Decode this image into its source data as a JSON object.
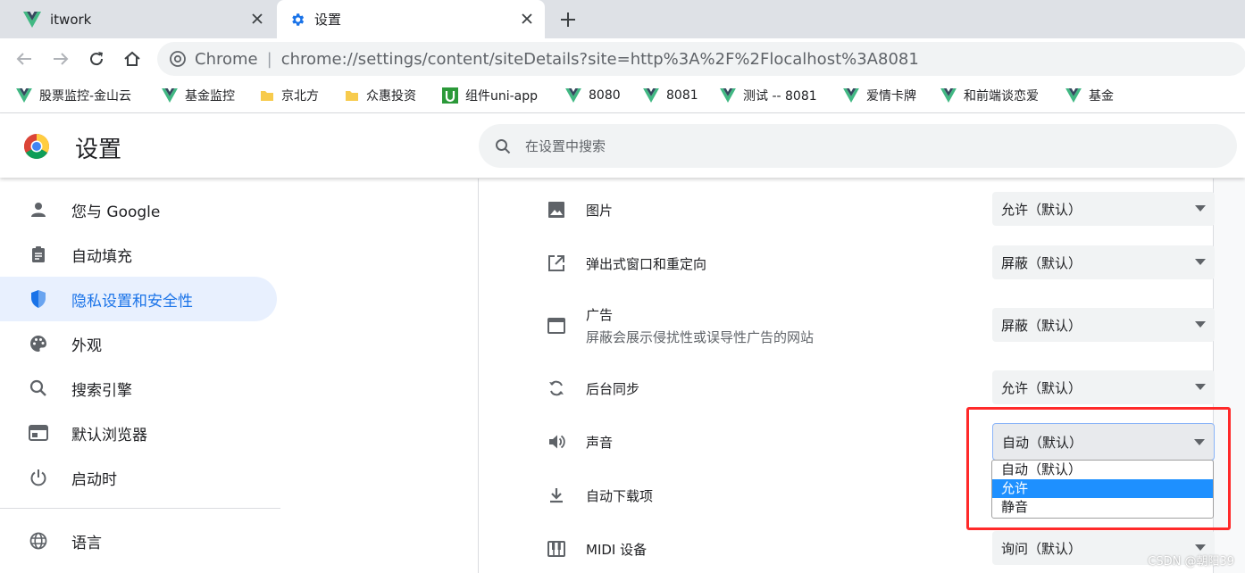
{
  "tabs": [
    {
      "title": "itwork",
      "icon": "vue-logo-icon"
    },
    {
      "title": "设置",
      "icon": "settings-gear-icon",
      "active": true
    }
  ],
  "toolbar": {
    "site_label": "Chrome",
    "url": "chrome://settings/content/siteDetails?site=http%3A%2F%2Flocalhost%3A8081"
  },
  "bookmarks": [
    {
      "label": "股票监控-金山云",
      "icon": "vue-logo-icon"
    },
    {
      "label": "基金监控",
      "icon": "vue-logo-icon"
    },
    {
      "label": "京北方",
      "icon": "folder-icon"
    },
    {
      "label": "众惠投资",
      "icon": "folder-icon"
    },
    {
      "label": "组件uni-app",
      "icon": "uniapp-logo-icon"
    },
    {
      "label": "8080",
      "icon": "vue-logo-icon"
    },
    {
      "label": "8081",
      "icon": "vue-logo-icon"
    },
    {
      "label": "测试 -- 8081",
      "icon": "vue-logo-icon"
    },
    {
      "label": "爱情卡牌",
      "icon": "vue-logo-icon"
    },
    {
      "label": "和前端谈恋爱",
      "icon": "vue-logo-icon"
    },
    {
      "label": "基金",
      "icon": "vue-logo-icon"
    }
  ],
  "header": {
    "title": "设置",
    "search_placeholder": "在设置中搜索"
  },
  "sidebar": {
    "items": [
      {
        "label": "您与 Google",
        "icon": "person-icon"
      },
      {
        "label": "自动填充",
        "icon": "clipboard-icon"
      },
      {
        "label": "隐私设置和安全性",
        "icon": "shield-icon",
        "active": true
      },
      {
        "label": "外观",
        "icon": "palette-icon"
      },
      {
        "label": "搜索引擎",
        "icon": "search-icon"
      },
      {
        "label": "默认浏览器",
        "icon": "browser-window-icon"
      },
      {
        "label": "启动时",
        "icon": "power-icon"
      }
    ],
    "language": {
      "label": "语言",
      "icon": "globe-icon"
    }
  },
  "permissions": [
    {
      "label": "图片",
      "value": "允许（默认）",
      "icon": "image-icon"
    },
    {
      "label": "弹出式窗口和重定向",
      "value": "屏蔽（默认）",
      "icon": "open-in-new-icon"
    },
    {
      "label": "广告",
      "sublabel": "屏蔽会展示侵扰性或误导性广告的网站",
      "value": "屏蔽（默认）",
      "icon": "web-window-icon"
    },
    {
      "label": "后台同步",
      "value": "允许（默认）",
      "icon": "sync-icon"
    },
    {
      "label": "声音",
      "value": "自动（默认）",
      "icon": "volume-icon"
    },
    {
      "label": "自动下载项",
      "value": "",
      "icon": "download-icon"
    },
    {
      "label": "MIDI 设备",
      "value": "询问（默认）",
      "icon": "piano-icon"
    }
  ],
  "sound_dropdown": {
    "options": [
      "自动（默认）",
      "允许",
      "静音"
    ],
    "highlighted": "允许"
  },
  "watermark": "CSDN @朝阳39",
  "colors": {
    "accent": "#1a73e8",
    "active_nav_bg": "#e8f0fe",
    "highlight_option": "#1e90ff",
    "annotation_box": "#ff2a2a",
    "vue_green": "#41b883"
  }
}
